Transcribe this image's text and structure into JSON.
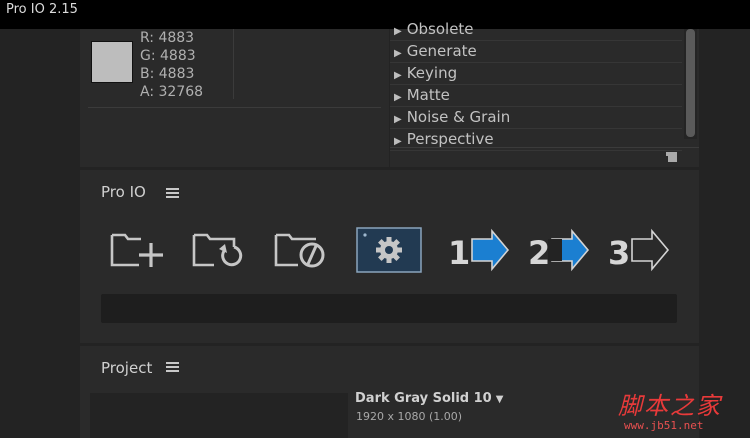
{
  "window": {
    "title": "Pro IO 2.15"
  },
  "info": {
    "r": "R: 4883",
    "g": "G: 4883",
    "b": "B: 4883",
    "a": "A: 32768"
  },
  "effects": {
    "items": [
      {
        "label": "Obsolete"
      },
      {
        "label": "Generate"
      },
      {
        "label": "Keying"
      },
      {
        "label": "Matte"
      },
      {
        "label": "Noise & Grain"
      },
      {
        "label": "Perspective"
      }
    ]
  },
  "proio": {
    "title": "Pro IO",
    "buttons": [
      "add-folder",
      "reload-folder",
      "disable-folder",
      "settings",
      "step-1",
      "step-2",
      "step-3"
    ],
    "step_labels": [
      "1",
      "2",
      "3"
    ]
  },
  "project": {
    "title": "Project",
    "item_name": "Dark Gray Solid 10",
    "item_size": "1920 x 1080 (1.00)"
  },
  "watermark": {
    "text": "脚本之家",
    "url": "www.jb51.net"
  },
  "colors": {
    "accent_blue": "#1b7fd1",
    "swatch": "#bdbdbd",
    "selected_bg": "#223a52"
  }
}
